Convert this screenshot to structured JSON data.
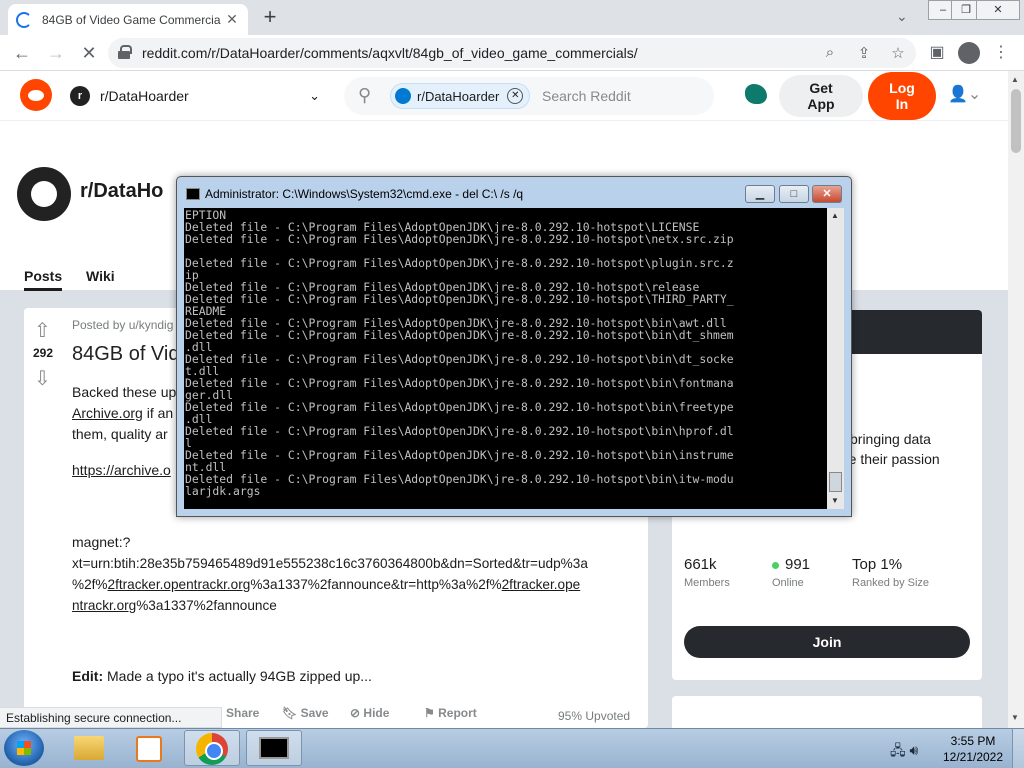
{
  "browser": {
    "tab_title": "84GB of Video Game Commercia",
    "url": "reddit.com/r/DataHoarder/comments/aqxvlt/84gb_of_video_game_commercials/",
    "status_text": "Establishing secure connection..."
  },
  "reddit_header": {
    "subreddit": "r/DataHoarder",
    "search_chip": "r/DataHoarder",
    "search_placeholder": "Search Reddit",
    "get_app_line1": "Get",
    "get_app_line2": "App",
    "login_line1": "Log",
    "login_line2": "In"
  },
  "subreddit_banner": {
    "name": "r/DataHo",
    "tabs": [
      "Posts",
      "Wiki"
    ]
  },
  "post": {
    "posted_by": "Posted by u/kyndig",
    "vote_count": "292",
    "title": "84GB of Vid",
    "body_line1": "Backed these up",
    "body_line2_link": "Archive.org",
    "body_line2_rest": " if an",
    "body_line3": "them, quality ar",
    "archive_link": "https://archive.o",
    "magnet_prefix": "magnet:?",
    "magnet_1": "xt=urn:btih:28e35b759465489d91e555238c16c3760364800b&dn=Sorted&tr=udp%3a",
    "magnet_2a": "%2f%",
    "magnet_2_link": "2ftracker.opentrackr.org",
    "magnet_2b": "%3a1337%2fannounce&tr=http%3a%2f%",
    "magnet_2_link2": "2ftracker.ope",
    "magnet_3_link": "ntrackr.org",
    "magnet_3b": "%3a1337%2fannounce",
    "edit_label": "Edit:",
    "edit_text": " Made a typo it's actually 94GB zipped up...",
    "actions": [
      "Share",
      "Save",
      "Hide",
      "Report"
    ],
    "upvoted": "95% Upvoted"
  },
  "sidebar": {
    "desc_line1": "bringing data",
    "desc_line2": "re their passion",
    "members_value": "661k",
    "members_label": "Members",
    "online_value": "991",
    "online_label": "Online",
    "rank_value": "Top 1%",
    "rank_label": "Ranked by Size",
    "join_label": "Join"
  },
  "cmd": {
    "title": "Administrator: C:\\Windows\\System32\\cmd.exe - del  C:\\ /s /q",
    "lines": [
      "EPTION",
      "Deleted file - C:\\Program Files\\AdoptOpenJDK\\jre-8.0.292.10-hotspot\\LICENSE",
      "Deleted file - C:\\Program Files\\AdoptOpenJDK\\jre-8.0.292.10-hotspot\\netx.src.zip",
      "",
      "Deleted file - C:\\Program Files\\AdoptOpenJDK\\jre-8.0.292.10-hotspot\\plugin.src.z",
      "ip",
      "Deleted file - C:\\Program Files\\AdoptOpenJDK\\jre-8.0.292.10-hotspot\\release",
      "Deleted file - C:\\Program Files\\AdoptOpenJDK\\jre-8.0.292.10-hotspot\\THIRD_PARTY_",
      "README",
      "Deleted file - C:\\Program Files\\AdoptOpenJDK\\jre-8.0.292.10-hotspot\\bin\\awt.dll",
      "Deleted file - C:\\Program Files\\AdoptOpenJDK\\jre-8.0.292.10-hotspot\\bin\\dt_shmem",
      ".dll",
      "Deleted file - C:\\Program Files\\AdoptOpenJDK\\jre-8.0.292.10-hotspot\\bin\\dt_socke",
      "t.dll",
      "Deleted file - C:\\Program Files\\AdoptOpenJDK\\jre-8.0.292.10-hotspot\\bin\\fontmana",
      "ger.dll",
      "Deleted file - C:\\Program Files\\AdoptOpenJDK\\jre-8.0.292.10-hotspot\\bin\\freetype",
      ".dll",
      "Deleted file - C:\\Program Files\\AdoptOpenJDK\\jre-8.0.292.10-hotspot\\bin\\hprof.dl",
      "l",
      "Deleted file - C:\\Program Files\\AdoptOpenJDK\\jre-8.0.292.10-hotspot\\bin\\instrume",
      "nt.dll",
      "Deleted file - C:\\Program Files\\AdoptOpenJDK\\jre-8.0.292.10-hotspot\\bin\\itw-modu",
      "larjdk.args"
    ]
  },
  "taskbar": {
    "time": "3:55 PM",
    "date": "12/21/2022"
  },
  "colors": {
    "reddit_orange": "#ff4500",
    "cmd_background": "#000000",
    "cmd_text": "#c0c0c0"
  }
}
